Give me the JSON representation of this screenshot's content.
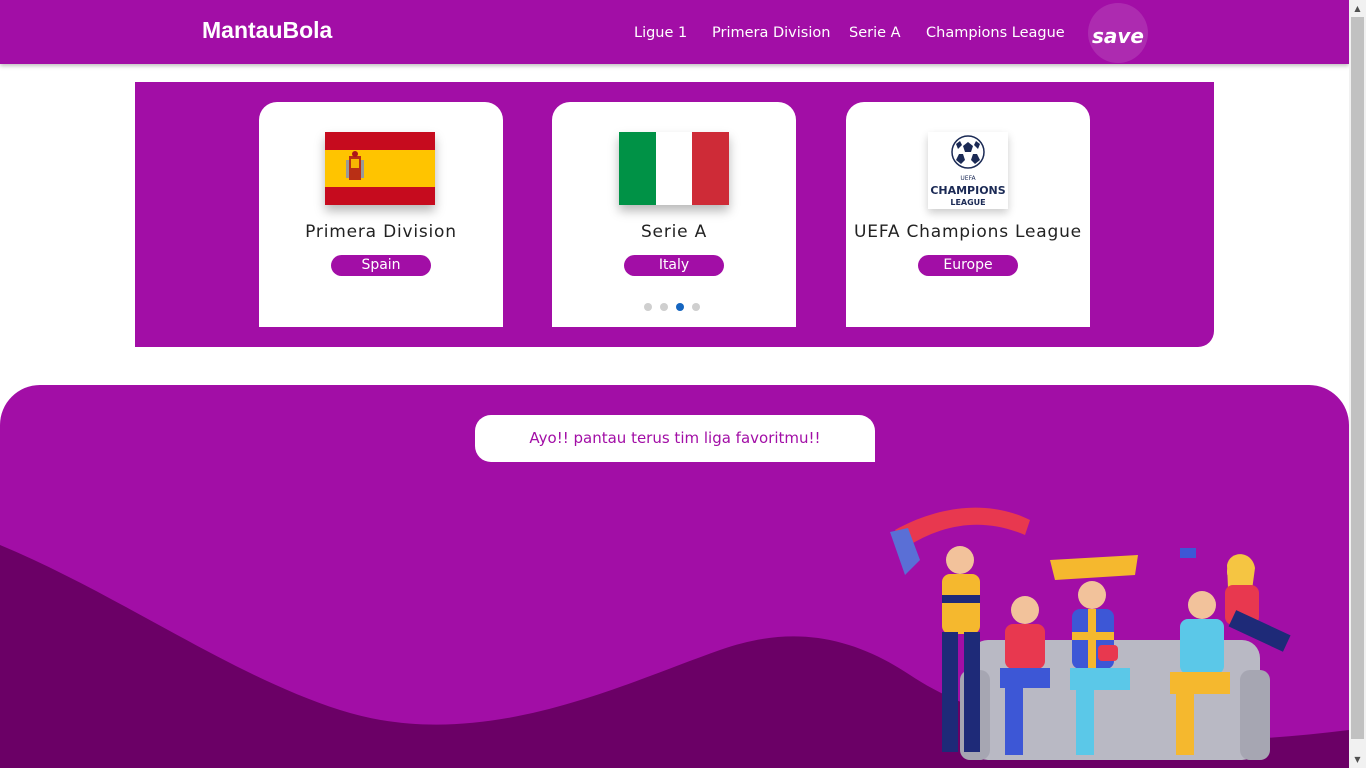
{
  "navbar": {
    "brand": "MantauBola",
    "links": [
      {
        "label": "Ligue 1"
      },
      {
        "label": "Primera Division"
      },
      {
        "label": "Serie A"
      },
      {
        "label": "Champions League"
      }
    ],
    "save_label": "save"
  },
  "carousel": {
    "cards": [
      {
        "title": "Primera Division",
        "country": "Spain",
        "flag": "spain-flag"
      },
      {
        "title": "Serie A",
        "country": "Italy",
        "flag": "italy-flag"
      },
      {
        "title": "UEFA Champions League",
        "country": "Europe",
        "flag": "champions-league-logo",
        "logo_text_1": "UEFA",
        "logo_text_2": "CHAMPIONS",
        "logo_text_3": "LEAGUE"
      }
    ],
    "dots": {
      "count": 4,
      "active_index": 2
    }
  },
  "hero": {
    "message": "Ayo!! pantau terus tim liga favoritmu!!",
    "illustration": "football-fans-cheering-on-sofa"
  },
  "colors": {
    "primary": "#a20ea6",
    "wave_dark": "#6b0066",
    "active_dot": "#1565c0"
  }
}
